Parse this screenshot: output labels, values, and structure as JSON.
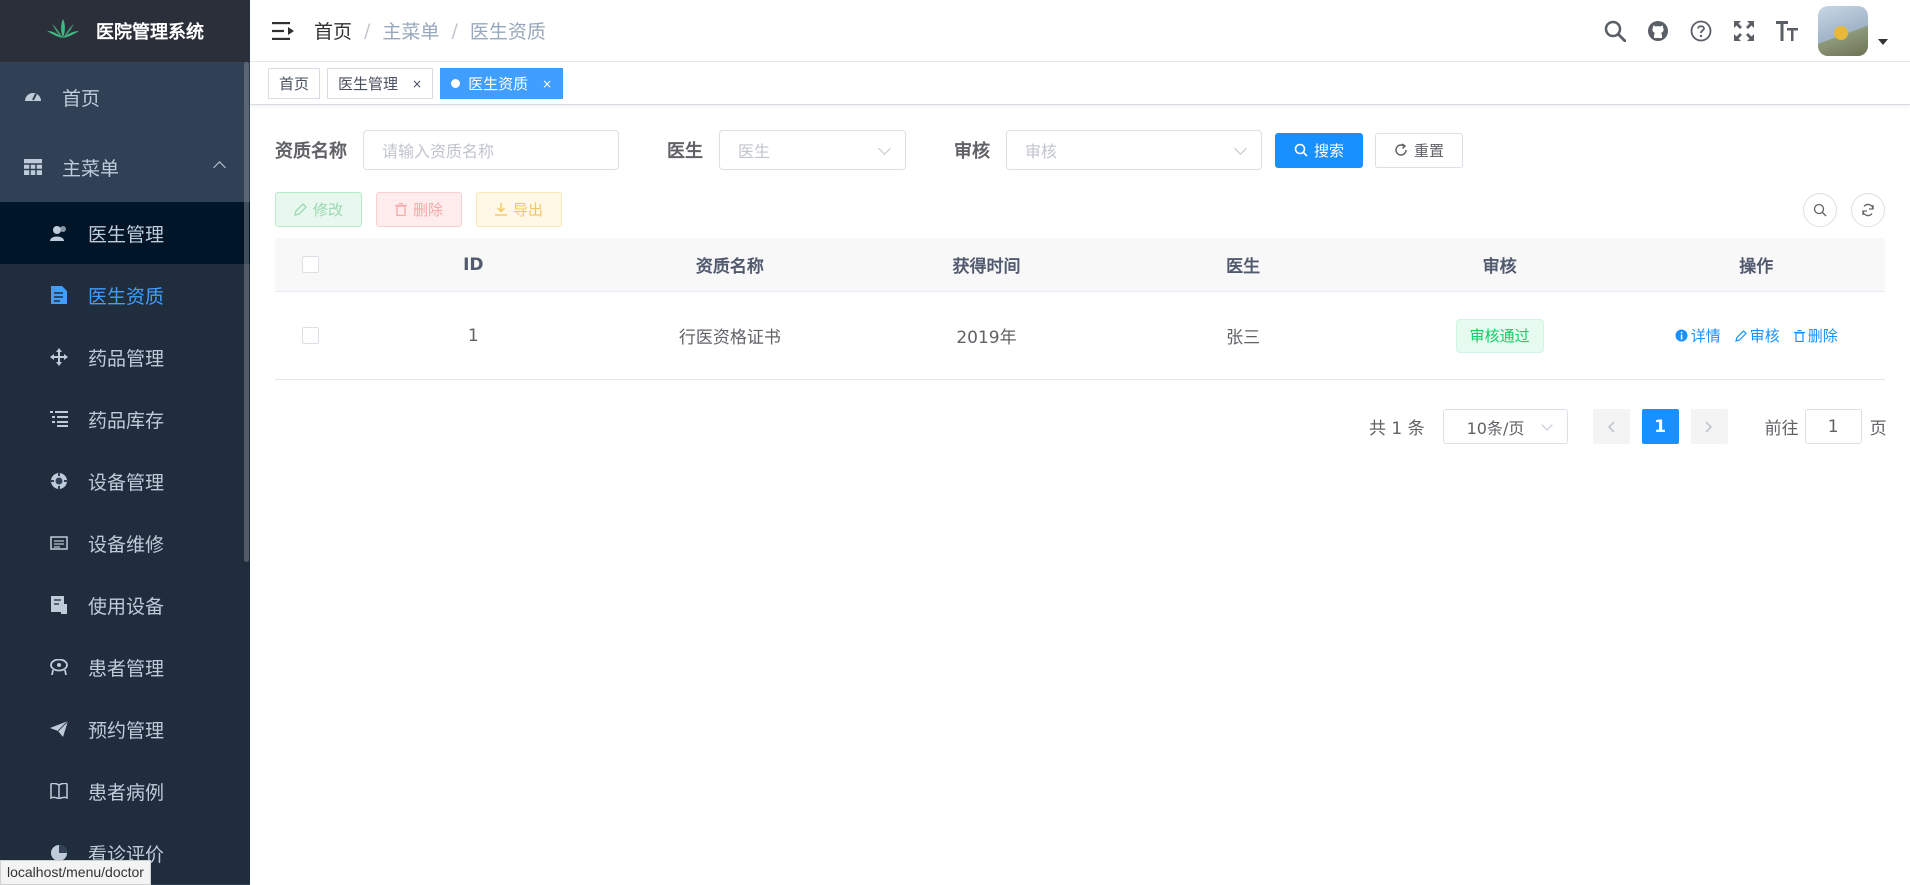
{
  "app": {
    "title": "医院管理系统",
    "status_url": "localhost/menu/doctor"
  },
  "sidebar": {
    "items": [
      {
        "label": "首页",
        "icon": "dashboard-icon"
      },
      {
        "label": "主菜单",
        "icon": "table-icon"
      },
      {
        "label": "医生管理",
        "icon": "peoples-icon"
      },
      {
        "label": "医生资质",
        "icon": "document-icon"
      },
      {
        "label": "药品管理",
        "icon": "drag-icon"
      },
      {
        "label": "药品库存",
        "icon": "list-icon"
      },
      {
        "label": "设备管理",
        "icon": "component-icon"
      },
      {
        "label": "设备维修",
        "icon": "log-icon"
      },
      {
        "label": "使用设备",
        "icon": "build-icon"
      },
      {
        "label": "患者管理",
        "icon": "people-icon"
      },
      {
        "label": "预约管理",
        "icon": "guide-icon"
      },
      {
        "label": "患者病例",
        "icon": "education-icon"
      },
      {
        "label": "看诊评价",
        "icon": "chart-icon"
      }
    ]
  },
  "breadcrumb": [
    "首页",
    "主菜单",
    "医生资质"
  ],
  "tags": [
    {
      "label": "首页"
    },
    {
      "label": "医生管理",
      "close": "×"
    },
    {
      "label": "医生资质",
      "close": "×"
    }
  ],
  "search": {
    "name_label": "资质名称",
    "name_placeholder": "请输入资质名称",
    "doctor_label": "医生",
    "doctor_placeholder": "医生",
    "audit_label": "审核",
    "audit_placeholder": "审核",
    "search_btn": "搜索",
    "reset_btn": "重置"
  },
  "toolbar": {
    "edit": "修改",
    "delete": "删除",
    "export": "导出"
  },
  "table": {
    "headers": [
      "ID",
      "资质名称",
      "获得时间",
      "医生",
      "审核",
      "操作"
    ],
    "rows": [
      {
        "id": "1",
        "name": "行医资格证书",
        "time": "2019年",
        "doctor": "张三",
        "audit": "审核通过",
        "ops": {
          "detail": "详情",
          "audit": "审核",
          "delete": "删除"
        }
      }
    ]
  },
  "pagination": {
    "total": "共 1 条",
    "page_size": "10条/页",
    "current": "1",
    "goto_label": "前往",
    "goto_value": "1",
    "goto_suffix": "页"
  },
  "colors": {
    "sidebar_bg": "#304156",
    "accent": "#1890ff",
    "active_menu": "#409eff",
    "success": "#13ce66"
  }
}
